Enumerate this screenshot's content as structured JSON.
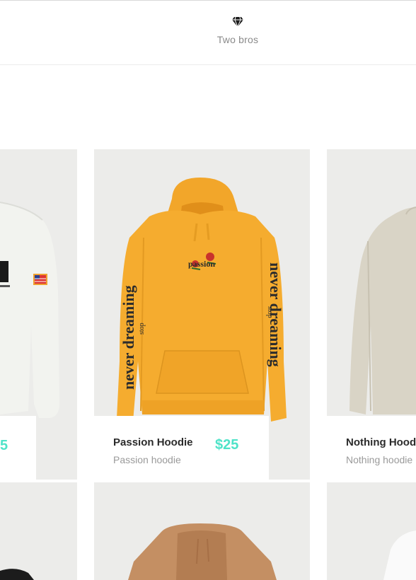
{
  "header": {
    "brand_icon": "diamond-icon",
    "brand_name": "Two bros"
  },
  "colors": {
    "price": "#4fe3c8",
    "image_bg": "#ececea",
    "hoodie_orange": "#f5ac2f",
    "hoodie_tan": "#c48f63",
    "sweater_beige": "#d9d4c6"
  },
  "products": [
    {
      "name": "",
      "subtitle": "",
      "price": "5"
    },
    {
      "name": "Passion Hoodie",
      "subtitle": "Passion hoodie",
      "price": "$25"
    },
    {
      "name": "Nothing Hood",
      "subtitle": "Nothing hoodie",
      "price": ""
    }
  ],
  "artwork": {
    "chest_text": "passion",
    "sleeve_text": "never dreaming",
    "sleeve_small": "stop"
  }
}
